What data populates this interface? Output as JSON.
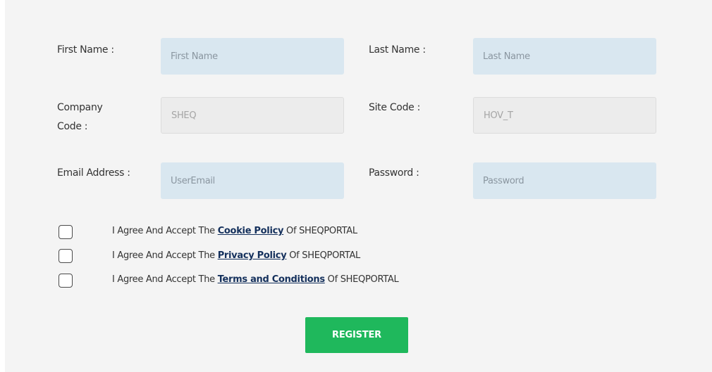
{
  "form": {
    "first_name": {
      "label": "First Name :",
      "placeholder": "First Name",
      "value": ""
    },
    "last_name": {
      "label": "Last Name :",
      "placeholder": "Last Name",
      "value": ""
    },
    "company_code": {
      "label_line1": "Company",
      "label_line2": "Code :",
      "value": "SHEQ"
    },
    "site_code": {
      "label": "Site Code :",
      "value": "HOV_T"
    },
    "email": {
      "label": "Email Address :",
      "placeholder": "UserEmail",
      "value": ""
    },
    "password": {
      "label": "Password :",
      "placeholder": "Password",
      "value": ""
    }
  },
  "agreements": [
    {
      "prefix": "I Agree And Accept The",
      "link": "Cookie Policy",
      "suffix": "Of SHEQPORTAL"
    },
    {
      "prefix": "I Agree And Accept The",
      "link": "Privacy Policy",
      "suffix": "Of SHEQPORTAL"
    },
    {
      "prefix": "I Agree And Accept The",
      "link": "Terms and Conditions",
      "suffix": "Of SHEQPORTAL"
    }
  ],
  "register_button": {
    "label": "REGISTER",
    "color": "#1fb85c"
  },
  "colors": {
    "input_background": "#d9e7f0",
    "readonly_background": "#ececec",
    "link": "#14305c",
    "panel_background": "#f4f4f4"
  }
}
